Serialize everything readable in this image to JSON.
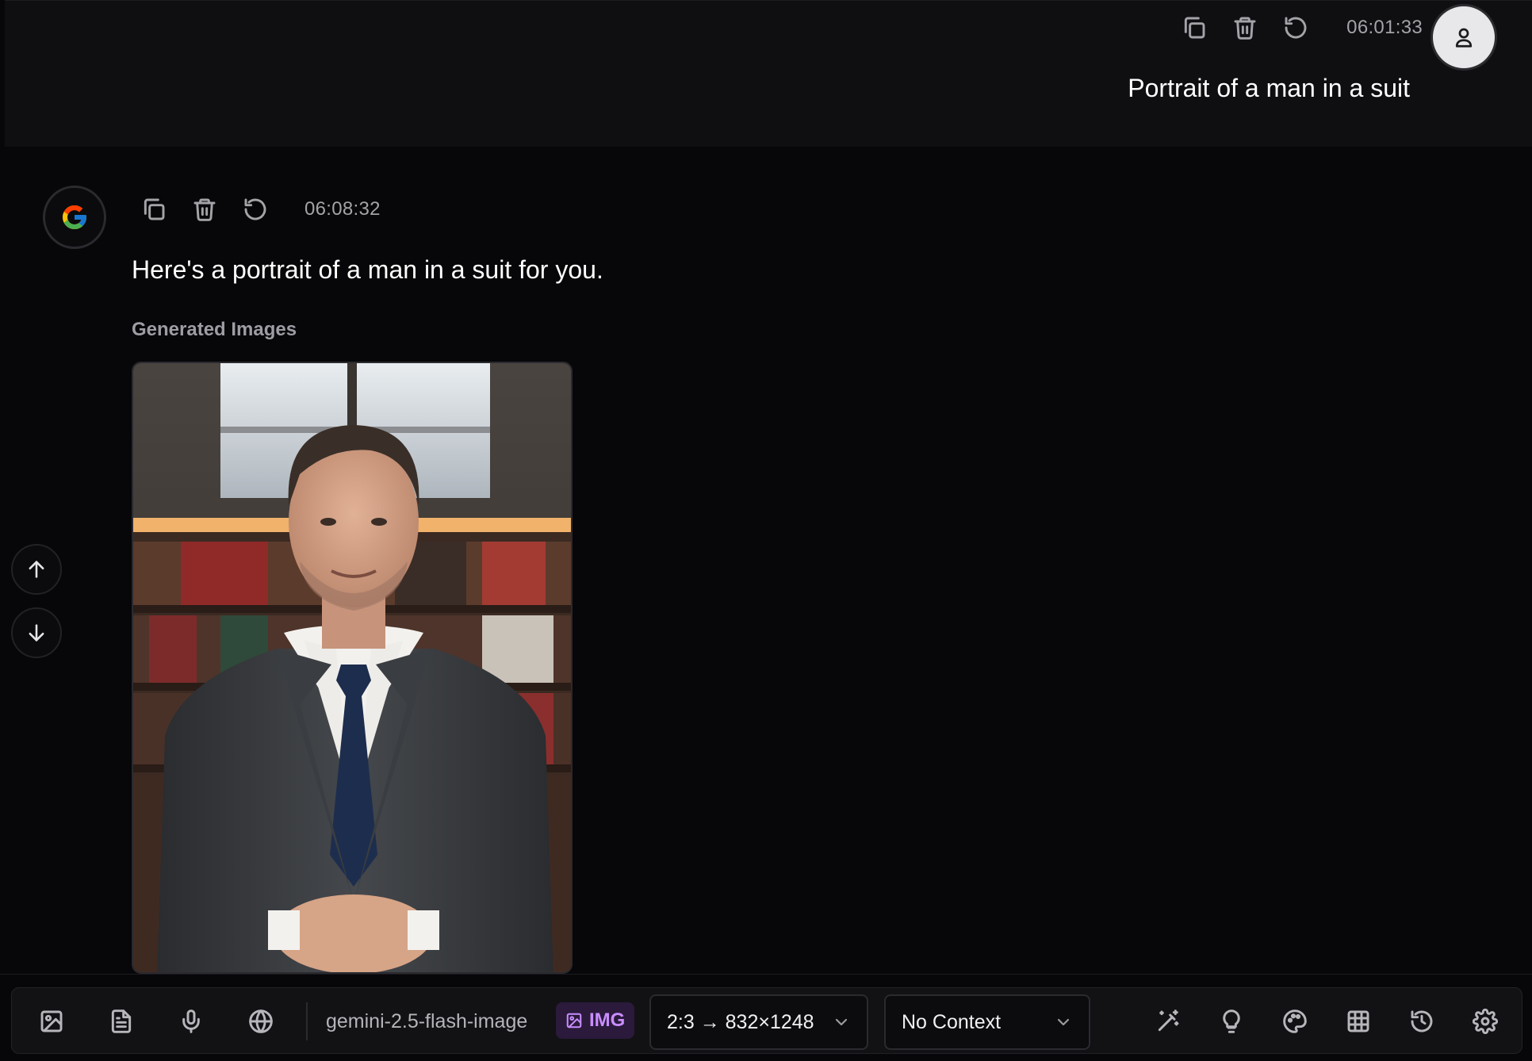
{
  "user_message": {
    "timestamp": "06:01:33",
    "text": "Portrait of a man in a suit",
    "actions": [
      "copy-icon",
      "trash-icon",
      "regenerate-icon"
    ],
    "avatar_icon": "user-icon"
  },
  "assistant_message": {
    "timestamp": "06:08:32",
    "text": "Here's a portrait of a man in a suit for you.",
    "generated_label": "Generated Images",
    "avatar_icon": "google-logo",
    "actions": [
      "copy-icon",
      "trash-icon",
      "regenerate-icon"
    ]
  },
  "scroll": {
    "up_icon": "arrow-up-icon",
    "down_icon": "arrow-down-icon"
  },
  "toolbar": {
    "left_icons": [
      "image-upload-icon",
      "document-icon",
      "microphone-icon",
      "globe-icon"
    ],
    "model": "gemini-2.5-flash-image",
    "badge": "IMG",
    "aspect_select": "2:3 → 832×1248",
    "context_select": "No Context",
    "right_icons": [
      "magic-wand-icon",
      "lightbulb-icon",
      "palette-icon",
      "table-icon",
      "history-icon",
      "settings-icon"
    ]
  },
  "colors": {
    "background": "#070709",
    "user_block": "#0f0f12",
    "badge_bg": "#2b1a3b",
    "badge_fg": "#c88dff"
  }
}
